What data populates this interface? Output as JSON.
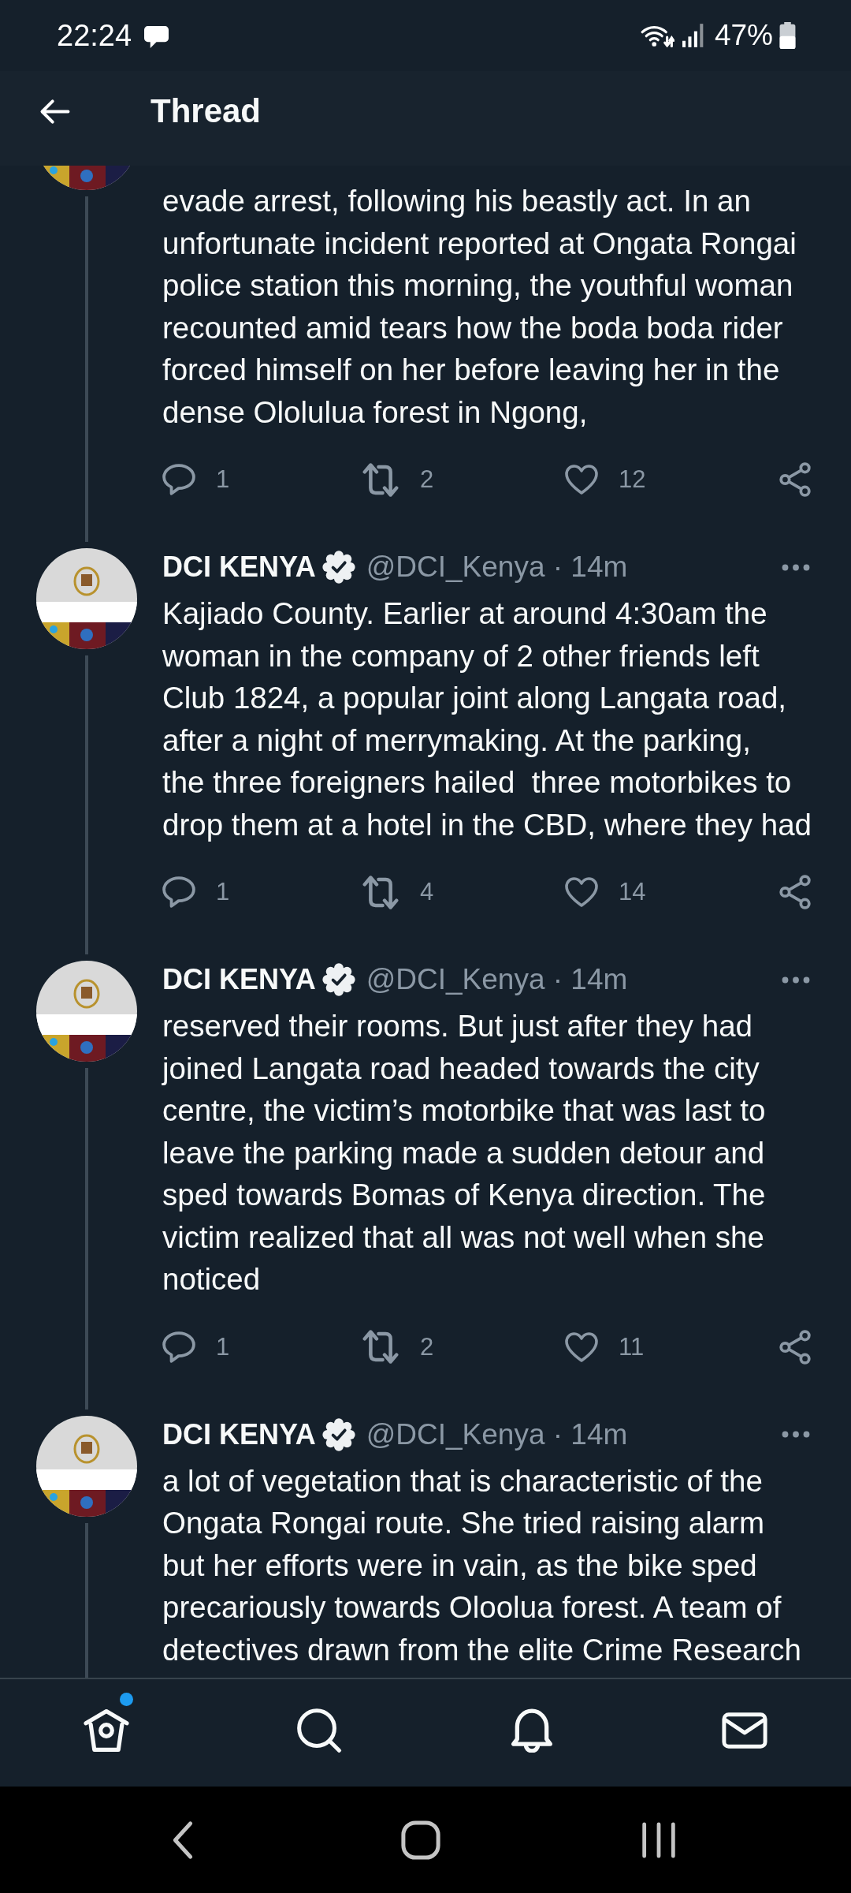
{
  "status_bar": {
    "time": "22:24",
    "battery": "47%"
  },
  "header": {
    "title": "Thread"
  },
  "tweets": [
    {
      "text": "evade arrest, following his beastly act. In an\nunfortunate incident reported at Ongata Rongai\npolice station this morning, the youthful woman\nrecounted amid tears how the boda boda rider\nforced himself on her before leaving her in the\ndense Ololulua forest in Ngong,",
      "stats": {
        "replies": "1",
        "retweets": "2",
        "likes": "12"
      }
    },
    {
      "author": {
        "name": "DCI KENYA",
        "verified": true,
        "byline": "@DCI_Kenya · 14m"
      },
      "text": "Kajiado County. Earlier at around 4:30am the\nwoman in the company of 2 other friends left\nClub 1824, a popular joint along Langata road,\nafter a night of merrymaking. At the parking,\nthe three foreigners hailed  three motorbikes to\ndrop them at a hotel in the CBD, where they had",
      "stats": {
        "replies": "1",
        "retweets": "4",
        "likes": "14"
      }
    },
    {
      "author": {
        "name": "DCI KENYA",
        "verified": true,
        "byline": "@DCI_Kenya · 14m"
      },
      "text": "reserved their rooms. But just after they had\njoined Langata road headed towards the city\ncentre, the victim’s motorbike that was last to\nleave the parking made a sudden detour and\nsped towards Bomas of Kenya direction. The\nvictim realized that all was not well when she\nnoticed",
      "stats": {
        "replies": "1",
        "retweets": "2",
        "likes": "11"
      }
    },
    {
      "author": {
        "name": "DCI KENYA",
        "verified": true,
        "byline": "@DCI_Kenya · 14m"
      },
      "text": "a lot of vegetation that is characteristic of the\nOngata Rongai route. She tried raising alarm\nbut her efforts were in vain, as the bike sped\nprecariously towards Oloolua forest. A team of\ndetectives drawn from the elite Crime Research"
    }
  ],
  "bottom_nav": {
    "items": [
      {
        "kind": "home",
        "dot": true
      },
      {
        "kind": "search",
        "dot": false
      },
      {
        "kind": "notifications",
        "dot": false
      },
      {
        "kind": "messages",
        "dot": false
      }
    ]
  }
}
